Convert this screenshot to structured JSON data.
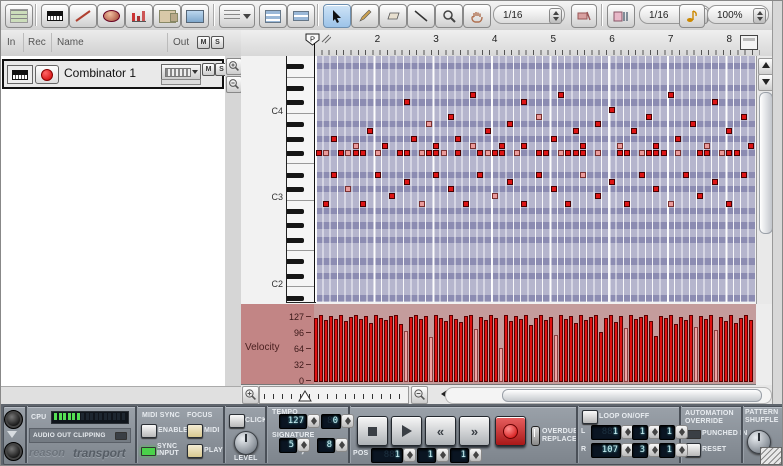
{
  "toolbar": {
    "snap_value": "1/16",
    "quantize_value": "1/16",
    "zoom_value": "100%"
  },
  "track_list": {
    "headers": {
      "in": "In",
      "rec": "Rec",
      "name": "Name",
      "out": "Out",
      "mute": "M",
      "solo": "S"
    },
    "tracks": [
      {
        "name": "Combinator 1",
        "mute": "M",
        "solo": "S"
      }
    ]
  },
  "sequencer": {
    "position_marker": "P",
    "ruler_bars": [
      "2",
      "3",
      "4",
      "5",
      "6",
      "7",
      "8"
    ],
    "key_labels": [
      {
        "row": 7,
        "label": "C4"
      },
      {
        "row": 19,
        "label": "C3"
      },
      {
        "row": 31,
        "label": "C2"
      }
    ],
    "grid": {
      "rows": 34,
      "cols": 60,
      "cols_per_bar": 8,
      "row_light": "#b5b5cd",
      "row_dark": "#8c8cb2",
      "note_color": "#dd1414"
    },
    "notes": [
      [
        0,
        13
      ],
      [
        1,
        13,
        1
      ],
      [
        3,
        13
      ],
      [
        4,
        13,
        1
      ],
      [
        5,
        13
      ],
      [
        6,
        13
      ],
      [
        8,
        13,
        1
      ],
      [
        11,
        13
      ],
      [
        12,
        13
      ],
      [
        14,
        13,
        1
      ],
      [
        15,
        13
      ],
      [
        16,
        13
      ],
      [
        17,
        13,
        1
      ],
      [
        19,
        13
      ],
      [
        22,
        13
      ],
      [
        23,
        13,
        1
      ],
      [
        24,
        13
      ],
      [
        25,
        13
      ],
      [
        27,
        13,
        1
      ],
      [
        30,
        13
      ],
      [
        31,
        13
      ],
      [
        33,
        13,
        1
      ],
      [
        34,
        13
      ],
      [
        35,
        13
      ],
      [
        36,
        13
      ],
      [
        38,
        13,
        1
      ],
      [
        41,
        13
      ],
      [
        42,
        13
      ],
      [
        44,
        13,
        1
      ],
      [
        45,
        13
      ],
      [
        46,
        13
      ],
      [
        47,
        13
      ],
      [
        49,
        13,
        1
      ],
      [
        52,
        13
      ],
      [
        53,
        13
      ],
      [
        55,
        13,
        1
      ],
      [
        56,
        13
      ],
      [
        57,
        13
      ],
      [
        2,
        11
      ],
      [
        5,
        12,
        1
      ],
      [
        7,
        10
      ],
      [
        9,
        12
      ],
      [
        12,
        6
      ],
      [
        13,
        11
      ],
      [
        15,
        9,
        1
      ],
      [
        16,
        12
      ],
      [
        18,
        8
      ],
      [
        19,
        11
      ],
      [
        21,
        5
      ],
      [
        21,
        12,
        1
      ],
      [
        23,
        10
      ],
      [
        25,
        12
      ],
      [
        26,
        9
      ],
      [
        28,
        6
      ],
      [
        28,
        12
      ],
      [
        30,
        8,
        1
      ],
      [
        32,
        11
      ],
      [
        33,
        5
      ],
      [
        35,
        10
      ],
      [
        36,
        12
      ],
      [
        38,
        9
      ],
      [
        40,
        7
      ],
      [
        41,
        12,
        1
      ],
      [
        43,
        10
      ],
      [
        45,
        8
      ],
      [
        46,
        12
      ],
      [
        48,
        5
      ],
      [
        49,
        11
      ],
      [
        51,
        9
      ],
      [
        53,
        12,
        1
      ],
      [
        54,
        6
      ],
      [
        56,
        10
      ],
      [
        58,
        8
      ],
      [
        59,
        12
      ],
      [
        1,
        20
      ],
      [
        2,
        16
      ],
      [
        4,
        18,
        1
      ],
      [
        6,
        20
      ],
      [
        8,
        16
      ],
      [
        10,
        19
      ],
      [
        12,
        17
      ],
      [
        14,
        20,
        1
      ],
      [
        16,
        16
      ],
      [
        18,
        18
      ],
      [
        20,
        20
      ],
      [
        22,
        16
      ],
      [
        24,
        19,
        1
      ],
      [
        26,
        17
      ],
      [
        28,
        20
      ],
      [
        30,
        16
      ],
      [
        32,
        18
      ],
      [
        34,
        20
      ],
      [
        36,
        16,
        1
      ],
      [
        38,
        19
      ],
      [
        40,
        17
      ],
      [
        42,
        20
      ],
      [
        44,
        16
      ],
      [
        46,
        18
      ],
      [
        48,
        20,
        1
      ],
      [
        50,
        16
      ],
      [
        52,
        19
      ],
      [
        54,
        17
      ],
      [
        56,
        20
      ],
      [
        58,
        16
      ]
    ],
    "velocity": {
      "label": "Velocity",
      "scale": [
        "127",
        "96",
        "64",
        "32",
        "0"
      ],
      "max": 127,
      "bars": [
        122,
        127,
        118,
        125,
        120,
        127,
        115,
        124,
        127,
        119,
        126,
        112,
        127,
        121,
        117,
        125,
        127,
        110,
        96,
        123,
        127,
        119,
        125,
        85,
        127,
        122,
        116,
        127,
        120,
        113,
        126,
        127,
        100,
        124,
        118,
        127,
        121,
        64,
        127,
        115,
        125,
        119,
        127,
        108,
        122,
        127,
        117,
        124,
        90,
        127,
        120,
        126,
        112,
        127,
        118,
        123,
        127,
        95,
        121,
        127,
        114,
        125,
        102,
        127,
        119,
        124,
        127,
        116,
        88,
        126,
        121,
        127,
        110,
        123,
        117,
        127,
        105,
        125,
        120,
        127,
        98,
        124,
        115,
        127,
        111,
        122,
        127,
        118
      ],
      "pale_bars": [
        18,
        23,
        32,
        37,
        48,
        62,
        76,
        80
      ]
    }
  },
  "transport": {
    "cpu_label": "CPU",
    "cpu_segments_lit": 6,
    "cpu_segments_total": 16,
    "audio_clip_label": "AUDIO OUT CLIPPING",
    "brand_left": "reason",
    "brand_right": "transport",
    "midi_sync_label": "MIDI SYNC",
    "focus_label": "FOCUS",
    "enable_label": "ENABLE",
    "midi_label": "MIDI",
    "sync_input_label": "SYNC INPUT",
    "play_label": "PLAY",
    "click_label": "CLICK",
    "level_label": "LEVEL",
    "tempo_label": "TEMPO",
    "signature_label": "SIGNATURE",
    "slash": "/",
    "pos_label": "POS",
    "overdub_label": "OVERDUB",
    "replace_label": "REPLACE",
    "loop_label": "LOOP ON/OFF",
    "l_label": "L",
    "r_label": "R",
    "automation_label": "AUTOMATION OVERRIDE",
    "punched_label": "PUNCHED IN",
    "reset_label": "RESET",
    "pattern_label": "PATTERN SHUFFLE",
    "values": {
      "tempo_bpm": "127",
      "tempo_dec": "0",
      "sig_num": "5",
      "sig_den": "8",
      "pos": [
        "1",
        "1",
        "1"
      ],
      "loop_l": [
        "1",
        "1",
        "1"
      ],
      "loop_r": [
        "107",
        "3",
        "1"
      ]
    }
  }
}
